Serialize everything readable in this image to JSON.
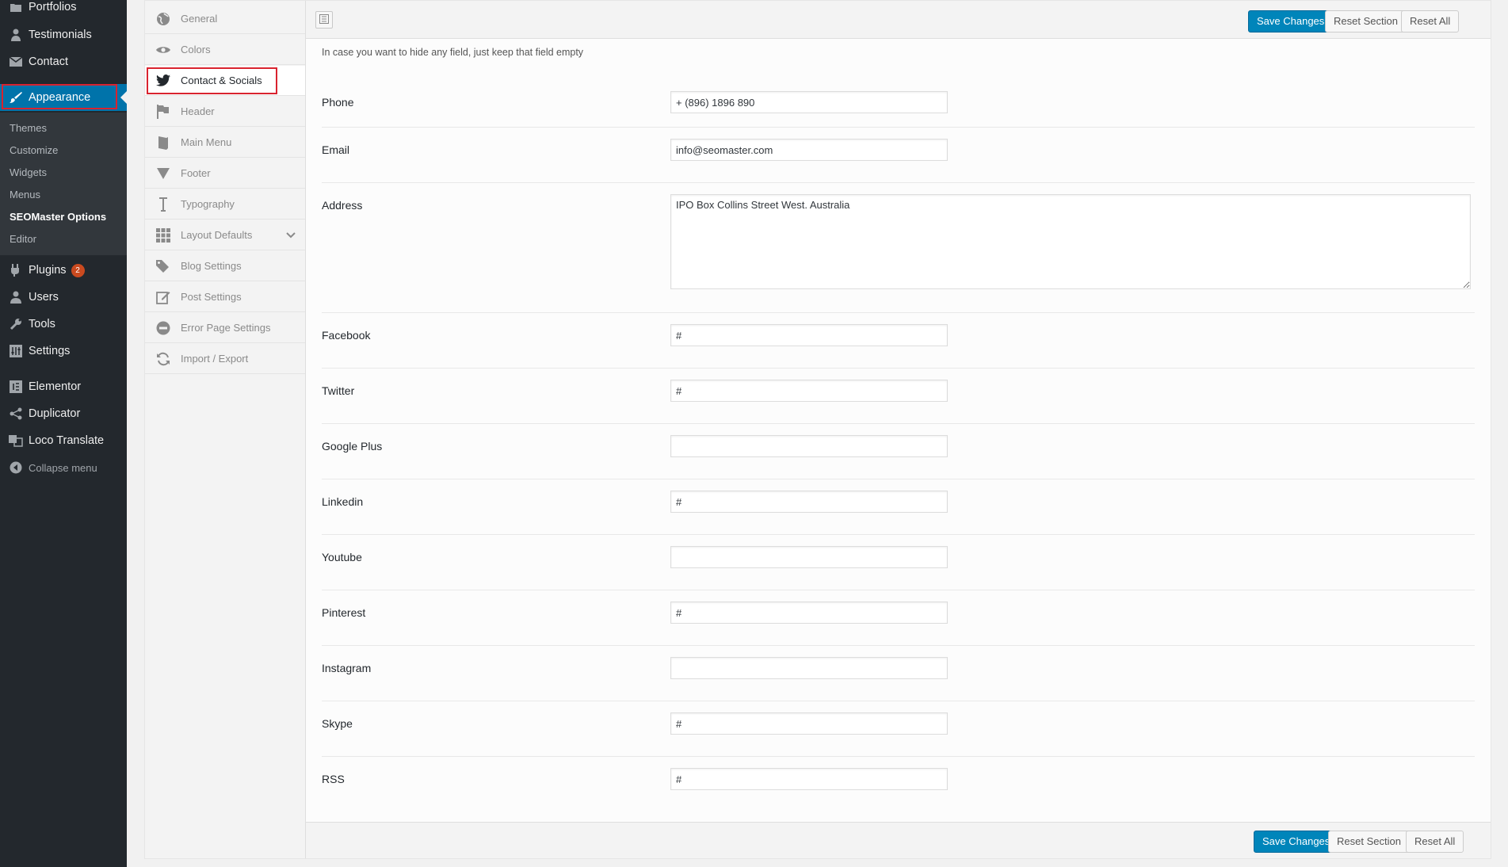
{
  "admin_menu": {
    "items_top": [
      {
        "label": "Portfolios",
        "icon": "portfolio-icon"
      },
      {
        "label": "Testimonials",
        "icon": "testimonial-icon"
      },
      {
        "label": "Contact",
        "icon": "mail-icon"
      }
    ],
    "current": {
      "label": "Appearance",
      "icon": "paintbrush-icon"
    },
    "submenu": [
      "Themes",
      "Customize",
      "Widgets",
      "Menus",
      "SEOMaster Options",
      "Editor"
    ],
    "submenu_current": "SEOMaster Options",
    "items_bottom": [
      {
        "label": "Plugins",
        "icon": "plugin-icon",
        "badge": "2"
      },
      {
        "label": "Users",
        "icon": "users-icon"
      },
      {
        "label": "Tools",
        "icon": "tools-icon"
      },
      {
        "label": "Settings",
        "icon": "settings-icon"
      }
    ],
    "items_extra": [
      {
        "label": "Elementor",
        "icon": "elementor-icon"
      },
      {
        "label": "Duplicator",
        "icon": "share-icon"
      },
      {
        "label": "Loco Translate",
        "icon": "translate-icon"
      }
    ],
    "collapse_label": "Collapse menu"
  },
  "options_nav": [
    {
      "label": "General",
      "icon": "globe-icon"
    },
    {
      "label": "Colors",
      "icon": "eye-icon"
    },
    {
      "label": "Contact & Socials",
      "icon": "twitter-icon"
    },
    {
      "label": "Header",
      "icon": "flag-icon"
    },
    {
      "label": "Main Menu",
      "icon": "book-icon"
    },
    {
      "label": "Footer",
      "icon": "arrow-down-icon"
    },
    {
      "label": "Typography",
      "icon": "text-icon"
    },
    {
      "label": "Layout Defaults",
      "icon": "grid-icon"
    },
    {
      "label": "Blog Settings",
      "icon": "tags-icon"
    },
    {
      "label": "Post Settings",
      "icon": "edit-icon"
    },
    {
      "label": "Error Page Settings",
      "icon": "minus-circle-icon"
    },
    {
      "label": "Import / Export",
      "icon": "refresh-icon"
    }
  ],
  "active_nav": "Contact & Socials",
  "toolbar": {
    "save_label": "Save Changes",
    "reset_section_label": "Reset Section",
    "reset_all_label": "Reset All"
  },
  "description": "In case you want to hide any field, just keep that field empty",
  "fields": {
    "phone": {
      "label": "Phone",
      "value": "+ (896) 1896 890"
    },
    "email": {
      "label": "Email",
      "value": "info@seomaster.com"
    },
    "address": {
      "label": "Address",
      "value": "IPO Box Collins Street West. Australia"
    },
    "facebook": {
      "label": "Facebook",
      "value": "#"
    },
    "twitter": {
      "label": "Twitter",
      "value": "#"
    },
    "google_plus": {
      "label": "Google Plus",
      "value": ""
    },
    "linkedin": {
      "label": "Linkedin",
      "value": "#"
    },
    "youtube": {
      "label": "Youtube",
      "value": ""
    },
    "pinterest": {
      "label": "Pinterest",
      "value": "#"
    },
    "instagram": {
      "label": "Instagram",
      "value": ""
    },
    "skype": {
      "label": "Skype",
      "value": "#"
    },
    "rss": {
      "label": "RSS",
      "value": "#"
    }
  },
  "colors": {
    "accent": "#0073aa",
    "primary_button": "#0085ba",
    "highlight": "#d9232f"
  }
}
